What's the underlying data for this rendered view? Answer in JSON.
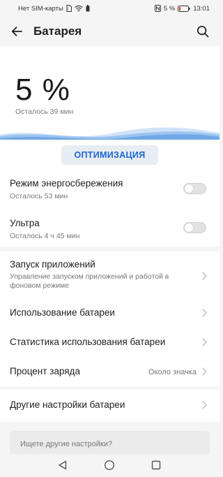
{
  "status_bar": {
    "carrier": "Нет SIM-карты",
    "battery_text": "5 %",
    "time": "13:01"
  },
  "app_bar": {
    "title": "Батарея"
  },
  "battery": {
    "percent": "5 %",
    "remaining": "Осталось 39 мин"
  },
  "optimize_label": "ОПТИМИЗАЦИЯ",
  "power_modes": [
    {
      "title": "Режим энергосбережения",
      "subtitle": "Осталось 53 мин"
    },
    {
      "title": "Ультра",
      "subtitle": "Осталось 4 ч 45 мин"
    }
  ],
  "settings": [
    {
      "title": "Запуск приложений",
      "subtitle": "Управление запуском приложений и работой в фоновом режиме"
    },
    {
      "title": "Использование батареи"
    },
    {
      "title": "Статистика использования батареи"
    },
    {
      "title": "Процент заряда",
      "value": "Около значка"
    }
  ],
  "other_settings": {
    "title": "Другие настройки батареи"
  },
  "search_prompt": "Ищете другие настройки?",
  "colors": {
    "accent": "#1b66d1",
    "wave": "#6fa8e8"
  },
  "icons": {
    "back": "arrow-left-icon",
    "search": "search-icon",
    "nav_back": "triangle-back-icon",
    "nav_home": "circle-home-icon",
    "nav_recents": "square-recents-icon"
  }
}
